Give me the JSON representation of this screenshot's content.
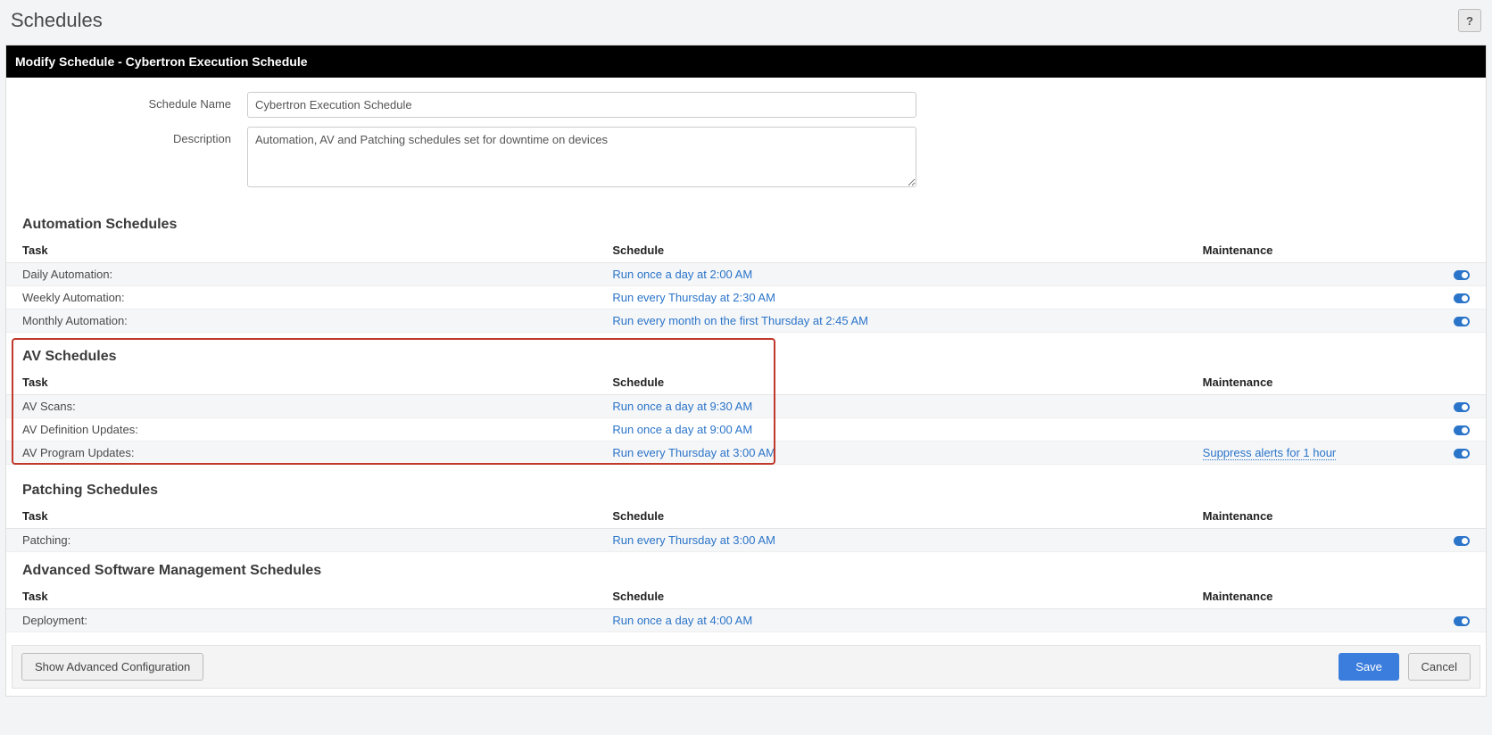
{
  "page": {
    "title": "Schedules"
  },
  "panel": {
    "header": "Modify Schedule - Cybertron Execution Schedule"
  },
  "form": {
    "schedule_name_label": "Schedule Name",
    "schedule_name_value": "Cybertron Execution Schedule",
    "description_label": "Description",
    "description_value": "Automation, AV and Patching schedules set for downtime on devices"
  },
  "columns": {
    "task": "Task",
    "schedule": "Schedule",
    "maintenance": "Maintenance"
  },
  "sections": {
    "automation": {
      "title": "Automation Schedules",
      "rows": [
        {
          "task": "Daily Automation:",
          "schedule": "Run once a day at 2:00 AM",
          "maint": "",
          "toggle": true
        },
        {
          "task": "Weekly Automation:",
          "schedule": "Run every Thursday at 2:30 AM",
          "maint": "",
          "toggle": true
        },
        {
          "task": "Monthly Automation:",
          "schedule": "Run every month on the first Thursday at 2:45 AM",
          "maint": "",
          "toggle": true
        }
      ]
    },
    "av": {
      "title": "AV Schedules",
      "rows": [
        {
          "task": "AV Scans:",
          "schedule": "Run once a day at 9:30 AM",
          "maint": "",
          "toggle": true
        },
        {
          "task": "AV Definition Updates:",
          "schedule": "Run once a day at 9:00 AM",
          "maint": "",
          "toggle": true
        },
        {
          "task": "AV Program Updates:",
          "schedule": "Run every Thursday at 3:00 AM",
          "maint": "Suppress alerts for 1 hour",
          "toggle": true
        }
      ]
    },
    "patching": {
      "title": "Patching Schedules",
      "rows": [
        {
          "task": "Patching:",
          "schedule": "Run every Thursday at 3:00 AM",
          "maint": "",
          "toggle": true
        }
      ]
    },
    "asm": {
      "title": "Advanced Software Management Schedules",
      "rows": [
        {
          "task": "Deployment:",
          "schedule": "Run once a day at 4:00 AM",
          "maint": "",
          "toggle": true
        }
      ]
    }
  },
  "footer": {
    "advanced": "Show Advanced Configuration",
    "save": "Save",
    "cancel": "Cancel"
  }
}
